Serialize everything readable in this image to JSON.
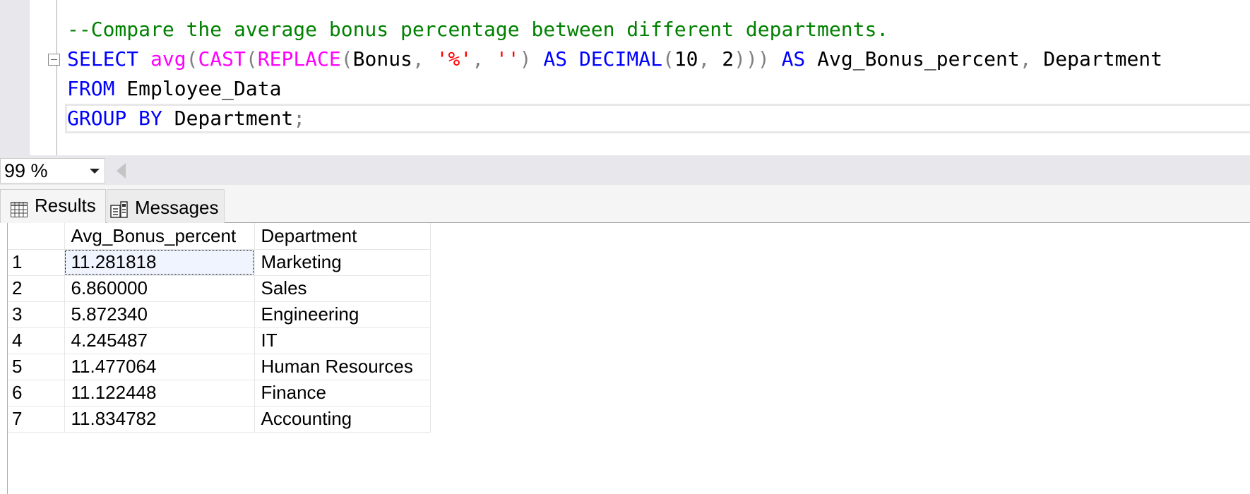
{
  "editor": {
    "lines": [
      [
        {
          "type": "comment",
          "text": "--Compare the average bonus percentage between different departments."
        }
      ],
      [
        {
          "type": "keyword",
          "text": "SELECT"
        },
        {
          "type": "ident",
          "text": " "
        },
        {
          "type": "func",
          "text": "avg"
        },
        {
          "type": "punct",
          "text": "("
        },
        {
          "type": "func",
          "text": "CAST"
        },
        {
          "type": "punct",
          "text": "("
        },
        {
          "type": "func",
          "text": "REPLACE"
        },
        {
          "type": "punct",
          "text": "("
        },
        {
          "type": "ident",
          "text": "Bonus"
        },
        {
          "type": "punct",
          "text": ", "
        },
        {
          "type": "string",
          "text": "'%'"
        },
        {
          "type": "punct",
          "text": ", "
        },
        {
          "type": "string",
          "text": "''"
        },
        {
          "type": "punct",
          "text": ")"
        },
        {
          "type": "ident",
          "text": " "
        },
        {
          "type": "keyword",
          "text": "AS"
        },
        {
          "type": "ident",
          "text": " "
        },
        {
          "type": "keyword",
          "text": "DECIMAL"
        },
        {
          "type": "punct",
          "text": "("
        },
        {
          "type": "ident",
          "text": "10"
        },
        {
          "type": "punct",
          "text": ", "
        },
        {
          "type": "ident",
          "text": "2"
        },
        {
          "type": "punct",
          "text": ")))"
        },
        {
          "type": "ident",
          "text": " "
        },
        {
          "type": "keyword",
          "text": "AS"
        },
        {
          "type": "ident",
          "text": " Avg_Bonus_percent"
        },
        {
          "type": "punct",
          "text": ","
        },
        {
          "type": "ident",
          "text": " Department"
        }
      ],
      [
        {
          "type": "keyword",
          "text": "FROM"
        },
        {
          "type": "ident",
          "text": " Employee_Data"
        }
      ],
      [
        {
          "type": "keyword",
          "text": "GROUP BY"
        },
        {
          "type": "ident",
          "text": " Department"
        },
        {
          "type": "punct",
          "text": ";"
        }
      ]
    ]
  },
  "zoom": {
    "value": "99 %"
  },
  "tabs": {
    "results_label": "Results",
    "messages_label": "Messages"
  },
  "results": {
    "columns": [
      "Avg_Bonus_percent",
      "Department"
    ],
    "rows": [
      {
        "num": "1",
        "avg": "11.281818",
        "dept": "Marketing"
      },
      {
        "num": "2",
        "avg": "6.860000",
        "dept": "Sales"
      },
      {
        "num": "3",
        "avg": "5.872340",
        "dept": "Engineering"
      },
      {
        "num": "4",
        "avg": "4.245487",
        "dept": "IT"
      },
      {
        "num": "5",
        "avg": "11.477064",
        "dept": "Human Resources"
      },
      {
        "num": "6",
        "avg": "11.122448",
        "dept": "Finance"
      },
      {
        "num": "7",
        "avg": "11.834782",
        "dept": "Accounting"
      }
    ]
  },
  "colors": {
    "comment": "#008000",
    "keyword": "#0000ff",
    "function": "#ff00ff",
    "string": "#ff0000",
    "punctuation": "#808080"
  }
}
